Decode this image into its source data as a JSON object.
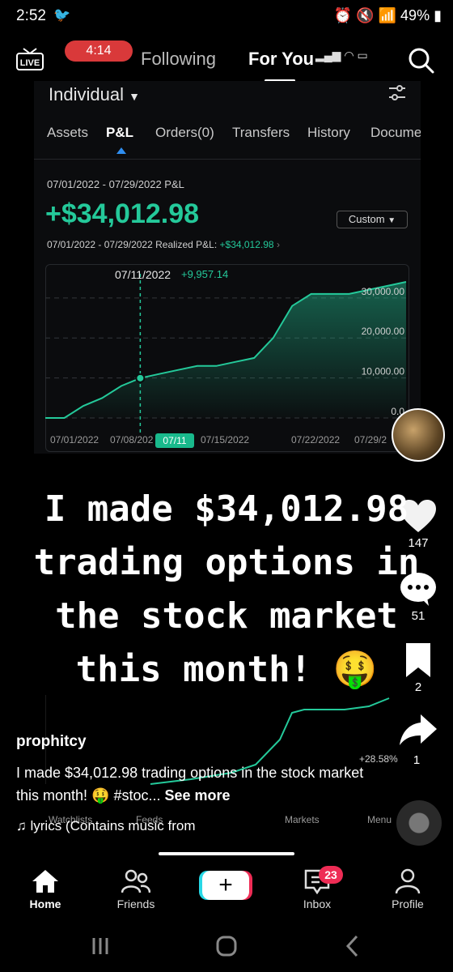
{
  "status_bar": {
    "time": "2:52",
    "battery": "49%"
  },
  "top_nav": {
    "live_label": "LIVE",
    "timer": "4:14",
    "following": "Following",
    "for_you": "For You"
  },
  "trading_app": {
    "account": "Individual",
    "tabs": [
      "Assets",
      "P&L",
      "Orders(0)",
      "Transfers",
      "History",
      "Docume"
    ],
    "active_tab": "P&L",
    "period_label": "07/01/2022 - 07/29/2022 P&L",
    "pnl_value": "+$34,012.98",
    "range_button": "Custom",
    "realized_label": "07/01/2022 - 07/29/2022 Realized P&L:",
    "realized_value": "+$34,012.98",
    "tooltip_date": "07/11/2022",
    "tooltip_value": "+9,957.14",
    "marker_label": "07/11",
    "lower_percent": "+28.58%",
    "bottom_labels": [
      "Watchlists",
      "Feeds",
      "Markets",
      "Menu"
    ]
  },
  "chart_data": {
    "type": "area",
    "x_tick_labels": [
      "07/01/2022",
      "07/08/202",
      "07/15/2022",
      "07/22/2022",
      "07/29/2"
    ],
    "y_tick_labels": [
      "0.0",
      "10,000.00",
      "20,000.00",
      "30,000.00"
    ],
    "ylim": [
      0,
      34012.98
    ],
    "x": [
      "07/01",
      "07/05",
      "07/06",
      "07/07",
      "07/08",
      "07/11",
      "07/12",
      "07/13",
      "07/14",
      "07/15",
      "07/18",
      "07/19",
      "07/20",
      "07/21",
      "07/22",
      "07/25",
      "07/26",
      "07/27",
      "07/28",
      "07/29"
    ],
    "values": [
      0,
      0,
      3000,
      5000,
      8000,
      9957.14,
      11000,
      12000,
      13000,
      13000,
      14000,
      15000,
      20000,
      28000,
      31000,
      31000,
      31000,
      32000,
      33000,
      34012.98
    ],
    "line_color": "#24c99a",
    "grid": true
  },
  "caption": {
    "lines": [
      "I made $34,012.98",
      "trading options in",
      "the stock market",
      "this month! 🤑"
    ]
  },
  "right_rail": {
    "likes": "147",
    "comments": "51",
    "saves": "2",
    "shares": "1"
  },
  "post": {
    "username": "prophitcy",
    "description": "I made $34,012.98 trading options in the stock market this month! 🤑 #stoc...",
    "see_more": "See more",
    "music": "lyrics (Contains music from"
  },
  "bottom_nav": {
    "home": "Home",
    "friends": "Friends",
    "inbox": "Inbox",
    "inbox_badge": "23",
    "profile": "Profile"
  },
  "colors": {
    "accent_green": "#24c99a",
    "badge_red": "#ee2c55",
    "timer_red": "#d9393a"
  }
}
